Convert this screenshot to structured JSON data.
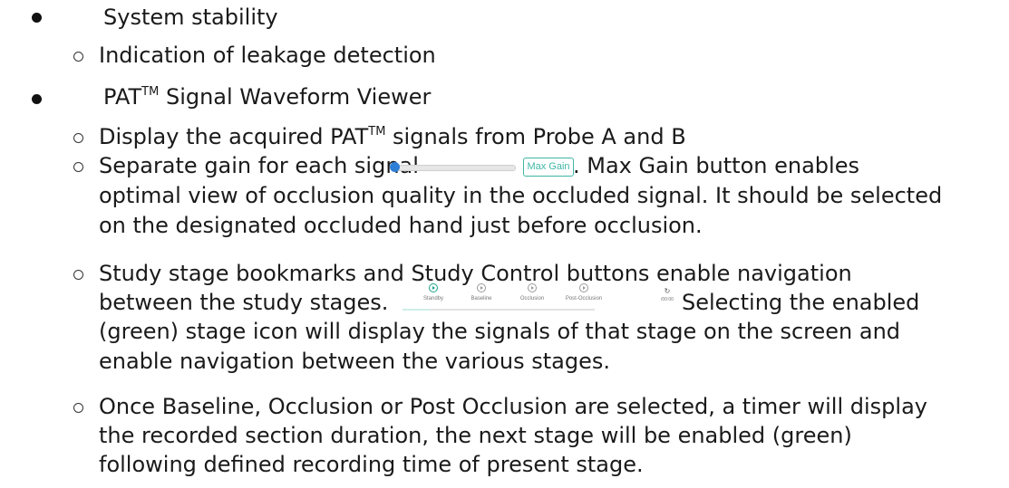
{
  "lines": {
    "l1": "System stability",
    "l2": "Indication of leakage detection",
    "l3_pre": "PAT",
    "l3_sup": "TM",
    "l3_post": " Signal Waveform Viewer",
    "l4_pre": "Display the acquired PAT",
    "l4_sup": "TM",
    "l4_post": " signals from Probe A and B",
    "l5_pre": "Separate gain for each signal",
    "l5_post": ". Max Gain button enables",
    "l6": "optimal view of occlusion quality in the occluded signal. It should be selected",
    "l7": "on the designated occluded hand just before occlusion.",
    "l8": "Study stage bookmarks and Study Control buttons enable navigation",
    "l9_pre": "between the study stages.",
    "l9_post": "Selecting the enabled",
    "l10": "(green) stage icon will display the signals of that stage on the screen and",
    "l11": "enable navigation between the various stages.",
    "l12": "Once Baseline, Occlusion or Post Occlusion are selected, a timer will display",
    "l13": "the recorded section duration, the next stage will be enabled (green)",
    "l14": "following defined recording time of present stage."
  },
  "gain_control": {
    "max_gain_label": "Max Gain",
    "slider_level": 0.0
  },
  "stage_bar": {
    "stages": [
      "Standby",
      "Baseline",
      "Occlusion",
      "Post-Occlusion"
    ],
    "active_stage": "Standby",
    "timer": "/00:00",
    "active_color": "#1aa38c"
  }
}
